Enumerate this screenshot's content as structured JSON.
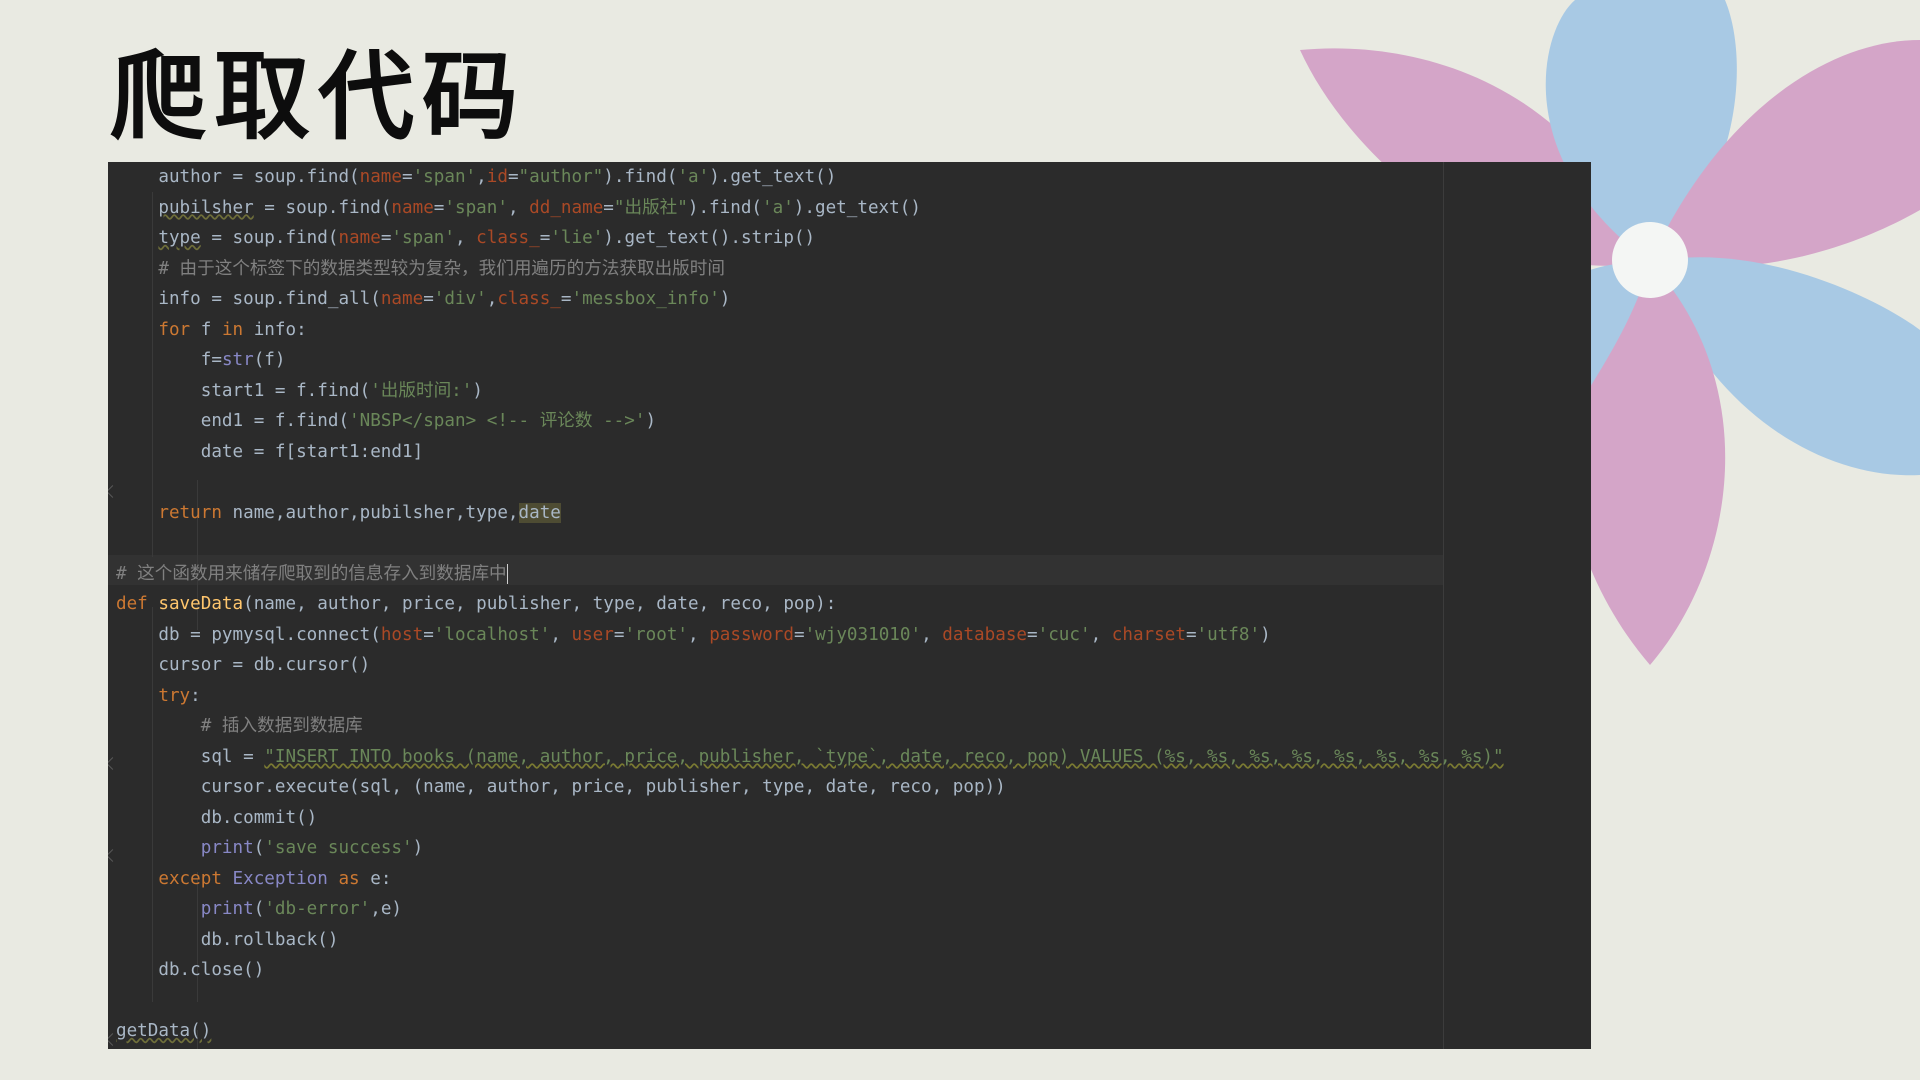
{
  "title": "爬取代码",
  "colors": {
    "background": "#e9eae2",
    "editor_bg": "#2b2b2b",
    "petal_pink": "#d4a5c8",
    "petal_blue": "#a8c9e4"
  },
  "code_lines": [
    [
      {
        "t": "    author = soup.find("
      },
      {
        "t": "name",
        "c": "pa"
      },
      {
        "t": "="
      },
      {
        "t": "'span'",
        "c": "st"
      },
      {
        "t": ","
      },
      {
        "t": "id",
        "c": "pa"
      },
      {
        "t": "="
      },
      {
        "t": "\"author\"",
        "c": "st"
      },
      {
        "t": ").find("
      },
      {
        "t": "'a'",
        "c": "st"
      },
      {
        "t": ").get_text()"
      }
    ],
    [
      {
        "t": "    "
      },
      {
        "t": "pubilsher",
        "c": "ul"
      },
      {
        "t": " = soup.find("
      },
      {
        "t": "name",
        "c": "pa"
      },
      {
        "t": "="
      },
      {
        "t": "'span'",
        "c": "st"
      },
      {
        "t": ", "
      },
      {
        "t": "dd_name",
        "c": "pa"
      },
      {
        "t": "="
      },
      {
        "t": "\"出版社\"",
        "c": "st"
      },
      {
        "t": ").find("
      },
      {
        "t": "'a'",
        "c": "st"
      },
      {
        "t": ").get_text()"
      }
    ],
    [
      {
        "t": "    "
      },
      {
        "t": "type",
        "c": "ul"
      },
      {
        "t": " = soup.find("
      },
      {
        "t": "name",
        "c": "pa"
      },
      {
        "t": "="
      },
      {
        "t": "'span'",
        "c": "st"
      },
      {
        "t": ", "
      },
      {
        "t": "class_",
        "c": "pa"
      },
      {
        "t": "="
      },
      {
        "t": "'lie'",
        "c": "st"
      },
      {
        "t": ").get_text().strip()"
      }
    ],
    [
      {
        "t": "    # 由于这个标签下的数据类型较为复杂，我们用遍历的方法获取出版时间",
        "c": "cm"
      }
    ],
    [
      {
        "t": "    info = soup.find_all("
      },
      {
        "t": "name",
        "c": "pa"
      },
      {
        "t": "="
      },
      {
        "t": "'div'",
        "c": "st"
      },
      {
        "t": ","
      },
      {
        "t": "class_",
        "c": "pa"
      },
      {
        "t": "="
      },
      {
        "t": "'messbox_info'",
        "c": "st"
      },
      {
        "t": ")"
      }
    ],
    [
      {
        "t": "    "
      },
      {
        "t": "for",
        "c": "kw"
      },
      {
        "t": " f "
      },
      {
        "t": "in",
        "c": "kw"
      },
      {
        "t": " info:"
      }
    ],
    [
      {
        "t": "        f=",
        "c": ""
      },
      {
        "t": "str",
        "c": "bi"
      },
      {
        "t": "(f)"
      }
    ],
    [
      {
        "t": "        start1 = f.find("
      },
      {
        "t": "'出版时间:'",
        "c": "st"
      },
      {
        "t": ")"
      }
    ],
    [
      {
        "t": "        end1 = f.find("
      },
      {
        "t": "'NBSP</span> <!-- 评论数 -->'",
        "c": "st"
      },
      {
        "t": ")"
      }
    ],
    [
      {
        "t": "        date = f[start1:end1]"
      }
    ],
    [
      {
        "t": ""
      }
    ],
    [
      {
        "t": "    "
      },
      {
        "t": "return",
        "c": "kw"
      },
      {
        "t": " name,author,pubilsher,type,"
      },
      {
        "t": "date",
        "c": "hl"
      }
    ],
    [
      {
        "t": ""
      }
    ],
    [
      {
        "t": "# 这个函数用来储存爬取到的信息存入到数据库中",
        "c": "cm"
      },
      {
        "t": "",
        "c": "caret"
      }
    ],
    [
      {
        "t": "def",
        "c": "kw"
      },
      {
        "t": " "
      },
      {
        "t": "saveData",
        "c": "fn"
      },
      {
        "t": "(name, author, price, publisher, type, date, reco, pop):"
      }
    ],
    [
      {
        "t": "    db = pymysql.connect("
      },
      {
        "t": "host",
        "c": "pa"
      },
      {
        "t": "="
      },
      {
        "t": "'localhost'",
        "c": "st"
      },
      {
        "t": ", "
      },
      {
        "t": "user",
        "c": "pa"
      },
      {
        "t": "="
      },
      {
        "t": "'root'",
        "c": "st"
      },
      {
        "t": ", "
      },
      {
        "t": "password",
        "c": "pa"
      },
      {
        "t": "="
      },
      {
        "t": "'wjy031010'",
        "c": "st"
      },
      {
        "t": ", "
      },
      {
        "t": "database",
        "c": "pa"
      },
      {
        "t": "="
      },
      {
        "t": "'cuc'",
        "c": "st"
      },
      {
        "t": ", "
      },
      {
        "t": "charset",
        "c": "pa"
      },
      {
        "t": "="
      },
      {
        "t": "'utf8'",
        "c": "st"
      },
      {
        "t": ")"
      }
    ],
    [
      {
        "t": "    cursor = db.cursor()"
      }
    ],
    [
      {
        "t": "    "
      },
      {
        "t": "try",
        "c": "kw"
      },
      {
        "t": ":"
      }
    ],
    [
      {
        "t": "        # 插入数据到数据库",
        "c": "cm"
      }
    ],
    [
      {
        "t": "        sql = "
      },
      {
        "t": "\"INSERT INTO books (name, author, price, publisher, `type`, date, reco, pop) VALUES (%s, %s, %s, %s, %s, %s, %s, %s)\"",
        "c": "st sqlstr"
      }
    ],
    [
      {
        "t": "        cursor.execute(sql, (name, author, price, publisher, type, date, reco, pop))"
      }
    ],
    [
      {
        "t": "        db.commit()"
      }
    ],
    [
      {
        "t": "        "
      },
      {
        "t": "print",
        "c": "bi"
      },
      {
        "t": "("
      },
      {
        "t": "'save success'",
        "c": "st"
      },
      {
        "t": ")"
      }
    ],
    [
      {
        "t": "    "
      },
      {
        "t": "except",
        "c": "kw"
      },
      {
        "t": " "
      },
      {
        "t": "Exception",
        "c": "bi"
      },
      {
        "t": " "
      },
      {
        "t": "as",
        "c": "kw"
      },
      {
        "t": " e:"
      }
    ],
    [
      {
        "t": "        "
      },
      {
        "t": "print",
        "c": "bi"
      },
      {
        "t": "("
      },
      {
        "t": "'db-error'",
        "c": "st"
      },
      {
        "t": ",e)"
      }
    ],
    [
      {
        "t": "        db.rollback()"
      }
    ],
    [
      {
        "t": "    db.close()"
      }
    ],
    [
      {
        "t": ""
      }
    ],
    [
      {
        "t": "getData()",
        "c": "ul"
      }
    ]
  ]
}
